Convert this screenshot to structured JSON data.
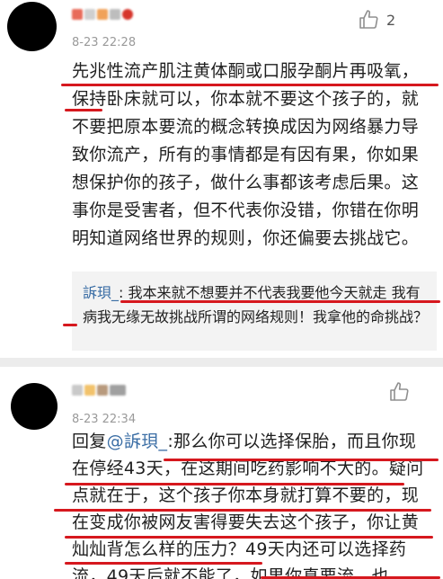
{
  "comment1": {
    "time": "8-23 22:28",
    "like_count": "2",
    "text": "先兆性流产肌注黄体酮或口服孕酮片再吸氧，保持卧床就可以，你本就不要这个孩子的，就不要把原本要流的概念转换成因为网络暴力导致你流产，所有的事情都是有因有果，你如果想保护你的孩子，做什么事都该考虑后果。这事你是受害者，但不代表你没错，你错在你明明知道网络世界的规则，你还偏要去挑战它。",
    "reply": {
      "user": "訴珼_",
      "sep": ": ",
      "text": "我本来就不想要并不代表我要他今天就走 我有病我无缘无故挑战所谓的网络规则！我拿他的命挑战？"
    }
  },
  "comment2": {
    "time": "8-23 22:34",
    "like_count": "",
    "prefix": "回复",
    "mention": "@訴珼_",
    "text": ":那么你可以选择保胎，而且你现在停经43天，在这期间吃药影响不大的。疑问点就在于，这个孩子你本身就打算不要的，现在变成你被网友害得要失去这个孩子，你让黄灿灿背怎么样的压力？49天内还可以选择药流，49天后就不能了，如果你真要流，也"
  },
  "colors": {
    "underline": "#d6181e",
    "link": "#3b6ea5"
  },
  "icons": {
    "like": "thumbs-up-icon"
  }
}
